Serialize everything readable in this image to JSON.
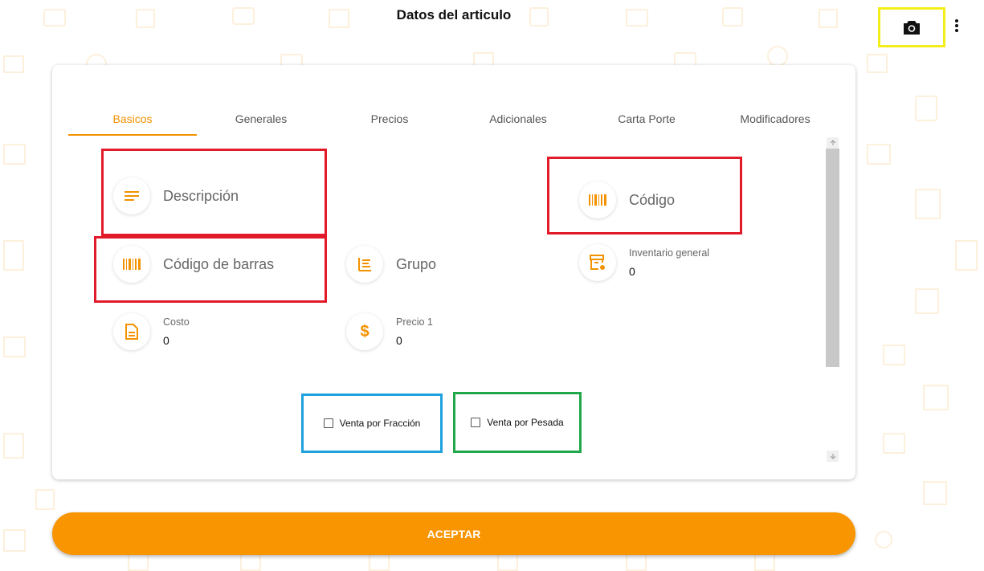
{
  "header": {
    "title": "Datos del articulo"
  },
  "toolbar": {
    "camera_icon": "camera-icon",
    "menu_icon": "more-vert-icon"
  },
  "tabs": [
    {
      "label": "Basicos",
      "active": true
    },
    {
      "label": "Generales",
      "active": false
    },
    {
      "label": "Precios",
      "active": false
    },
    {
      "label": "Adicionales",
      "active": false
    },
    {
      "label": "Carta Porte",
      "active": false
    },
    {
      "label": "Modificadores",
      "active": false
    }
  ],
  "fields": {
    "descripcion": {
      "label": "Descripción",
      "icon": "notes-icon"
    },
    "codigo": {
      "label": "Código",
      "icon": "barcode-icon"
    },
    "codigo_barras": {
      "label": "Código de barras",
      "icon": "barcode-icon"
    },
    "grupo": {
      "label": "Grupo",
      "icon": "list-icon"
    },
    "inventario": {
      "label": "Inventario general",
      "value": "0",
      "icon": "inventory-icon"
    },
    "costo": {
      "label": "Costo",
      "value": "0",
      "icon": "document-icon"
    },
    "precio1": {
      "label": "Precio 1",
      "value": "0",
      "icon": "dollar-icon"
    }
  },
  "checkboxes": {
    "fraccion": {
      "label": "Venta por Fracción",
      "checked": false
    },
    "pesada": {
      "label": "Venta por Pesada",
      "checked": false
    }
  },
  "footer": {
    "accept_label": "ACEPTAR"
  },
  "colors": {
    "accent": "#f39200",
    "button": "#f99500",
    "highlight_red": "#e21b2b",
    "highlight_yellow": "#f3ee1a",
    "highlight_blue": "#1ea1dc",
    "highlight_green": "#21a84a"
  }
}
